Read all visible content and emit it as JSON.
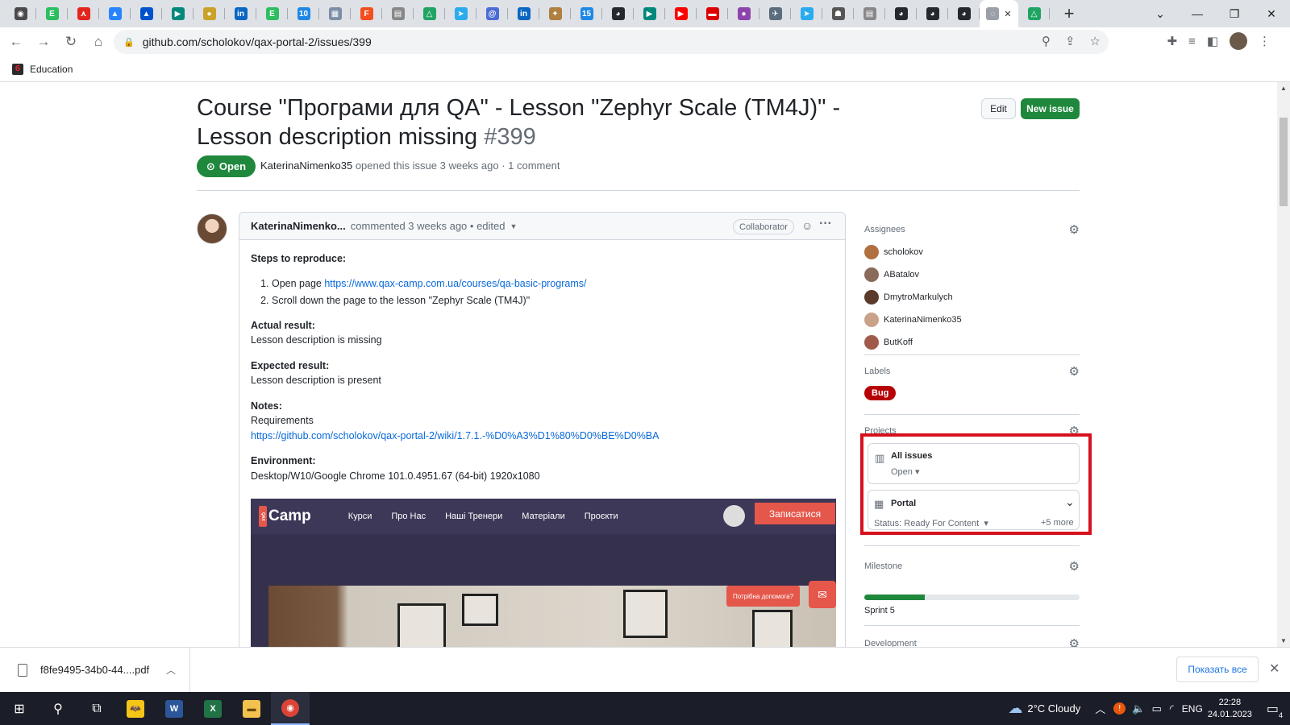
{
  "browser": {
    "url": "github.com/scholokov/qax-portal-2/issues/399",
    "bookmark": "Education",
    "tabs": [
      {
        "icon": "chrome-icon",
        "color": "#4a4a4a",
        "glyph": "◉"
      },
      {
        "icon": "evernote-icon",
        "color": "#2dbe60",
        "glyph": "E"
      },
      {
        "icon": "acrobat-icon",
        "color": "#e3261d",
        "glyph": "⋏"
      },
      {
        "icon": "atlassian-icon",
        "color": "#2684ff",
        "glyph": "▲"
      },
      {
        "icon": "atlassian-icon",
        "color": "#0052cc",
        "glyph": "▲"
      },
      {
        "icon": "google-meet-icon",
        "color": "#00897b",
        "glyph": "▶"
      },
      {
        "icon": "coin-icon",
        "color": "#c9a227",
        "glyph": "●"
      },
      {
        "icon": "linkedin-icon",
        "color": "#0a66c2",
        "glyph": "in"
      },
      {
        "icon": "evernote-icon",
        "color": "#2dbe60",
        "glyph": "E"
      },
      {
        "icon": "calendar-icon",
        "color": "#1e88e5",
        "glyph": "10"
      },
      {
        "icon": "image-icon",
        "color": "#7a8fa6",
        "glyph": "▦"
      },
      {
        "icon": "figma-icon",
        "color": "#f24e1e",
        "glyph": "F"
      },
      {
        "icon": "document-icon",
        "color": "#888888",
        "glyph": "▤"
      },
      {
        "icon": "google-drive-icon",
        "color": "#1fa463",
        "glyph": "△"
      },
      {
        "icon": "telegram-icon",
        "color": "#2aabee",
        "glyph": "➤"
      },
      {
        "icon": "teams-icon",
        "color": "#4b6bd6",
        "glyph": "@"
      },
      {
        "icon": "linkedin-icon",
        "color": "#0a66c2",
        "glyph": "in"
      },
      {
        "icon": "photo-icon",
        "color": "#b08040",
        "glyph": "✦"
      },
      {
        "icon": "calendar-icon",
        "color": "#1e88e5",
        "glyph": "15"
      },
      {
        "icon": "github-icon",
        "color": "#24292f",
        "glyph": "◕"
      },
      {
        "icon": "google-meet-icon",
        "color": "#00897b",
        "glyph": "▶"
      },
      {
        "icon": "youtube-icon",
        "color": "#ff0000",
        "glyph": "▶"
      },
      {
        "icon": "flag-icon",
        "color": "#dd0000",
        "glyph": "▬"
      },
      {
        "icon": "avatar-icon",
        "color": "#8e44ad",
        "glyph": "●"
      },
      {
        "icon": "airplane-icon",
        "color": "#5b6c7d",
        "glyph": "✈"
      },
      {
        "icon": "telegram-icon",
        "color": "#2aabee",
        "glyph": "➤"
      },
      {
        "icon": "robot-icon",
        "color": "#555555",
        "glyph": "☗"
      },
      {
        "icon": "document-icon",
        "color": "#888888",
        "glyph": "▤"
      },
      {
        "icon": "github-icon",
        "color": "#24292f",
        "glyph": "◕"
      },
      {
        "icon": "github-icon",
        "color": "#24292f",
        "glyph": "◕"
      },
      {
        "icon": "github-icon",
        "color": "#24292f",
        "glyph": "◕"
      },
      {
        "icon": "loading-icon",
        "color": "#9aa0a6",
        "glyph": "◌"
      },
      {
        "icon": "google-drive-icon",
        "color": "#1fa463",
        "glyph": "△"
      }
    ]
  },
  "issue": {
    "title": "Course \"Програми для QA\" - Lesson \"Zephyr Scale (TM4J)\" - Lesson description missing",
    "number": "#399",
    "edit_label": "Edit",
    "new_issue_label": "New issue",
    "state": "Open",
    "author": "KaterinaNimenko35",
    "opened_text": "opened this issue 3 weeks ago · 1 comment"
  },
  "comment": {
    "author": "KaterinaNimenko...",
    "meta": "commented 3 weeks ago • edited",
    "badge": "Collaborator",
    "steps_heading": "Steps to reproduce:",
    "step1_prefix": "Open page ",
    "step1_link": "https://www.qax-camp.com.ua/courses/qa-basic-programs/",
    "step2": "Scroll down the page to the lesson \"Zephyr Scale (TM4J)\"",
    "actual_heading": "Actual result:",
    "actual": "Lesson description is missing",
    "expected_heading": "Expected result:",
    "expected": "Lesson description is present",
    "notes_heading": "Notes:",
    "notes_text": "Requirements",
    "notes_link": "https://github.com/scholokov/qax-portal-2/wiki/1.7.1.-%D0%A3%D1%80%D0%BE%D0%BA",
    "env_heading": "Environment:",
    "env": "Desktop/W10/Google Chrome 101.0.4951.67 (64-bit) 1920x1080",
    "screenshot": {
      "logo": "Camp",
      "logo_mark": "QAX",
      "nav": [
        "Курси",
        "Про Нас",
        "Наші Тренери",
        "Матеріали",
        "Проєкти"
      ],
      "signup": "Записатися",
      "help": "Потрібна допомога?"
    }
  },
  "sidebar": {
    "assignees_title": "Assignees",
    "assignees": [
      {
        "name": "scholokov",
        "color": "#b07040"
      },
      {
        "name": "ABatalov",
        "color": "#8a6a5a"
      },
      {
        "name": "DmytroMarkulych",
        "color": "#5a3a2a"
      },
      {
        "name": "KaterinaNimenko35",
        "color": "#caa189"
      },
      {
        "name": "ButKoff",
        "color": "#a05a4a"
      }
    ],
    "labels_title": "Labels",
    "label": "Bug",
    "projects_title": "Projects",
    "project1_name": "All issues",
    "project1_status": "Open",
    "project2_name": "Portal",
    "project2_status": "Status: Ready For Content",
    "project2_more": "+5 more",
    "milestone_title": "Milestone",
    "milestone_name": "Sprint 5",
    "milestone_progress": 0.28,
    "development_title": "Development"
  },
  "download": {
    "file": "f8fe9495-34b0-44....pdf",
    "show_all": "Показать все"
  },
  "taskbar": {
    "weather": "2°C  Cloudy",
    "lang": "ENG",
    "time": "22:28",
    "date": "24.01.2023",
    "notifications": "4"
  }
}
